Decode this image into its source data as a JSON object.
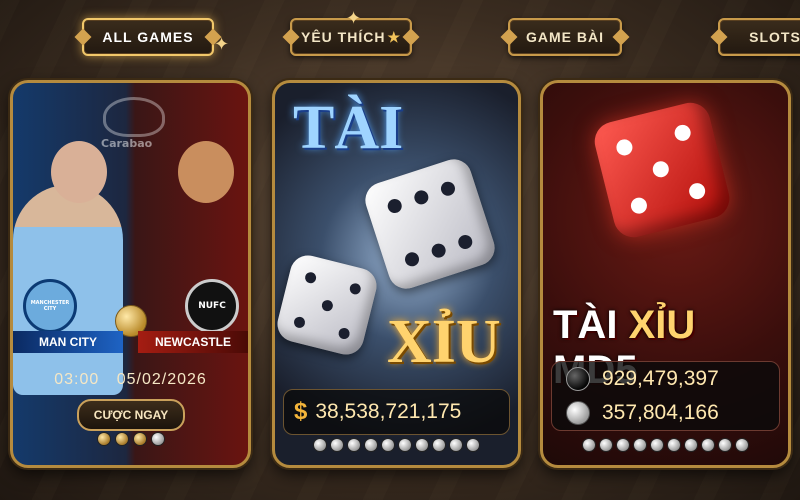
{
  "tabs": [
    {
      "label": "ALL GAMES"
    },
    {
      "label": "YÊU THÍCH",
      "star": "★"
    },
    {
      "label": "GAME BÀI"
    },
    {
      "label": "SLOTS"
    }
  ],
  "sports_card": {
    "brand": "Carabao",
    "home_team": "MAN CITY",
    "away_team": "NEWCASTLE",
    "home_badge": "MANCHESTER CITY",
    "away_badge": "NUFC",
    "match_time": "03:00",
    "match_date": "05/02/2026",
    "bet_button": "CƯỢC NGAY"
  },
  "taixiu_card": {
    "title_top": "TÀI",
    "title_bottom": "XỈU",
    "currency_symbol": "$",
    "jackpot": "38,538,721,175"
  },
  "md5_card": {
    "title_tai": "TÀI",
    "title_xiu": "XỈU",
    "title_md5": "MD5",
    "pool_dark": "929,479,397",
    "pool_light": "357,804,166"
  },
  "colors": {
    "gold_accent": "#c89a4a",
    "brand_bg": "#3a2c20"
  }
}
